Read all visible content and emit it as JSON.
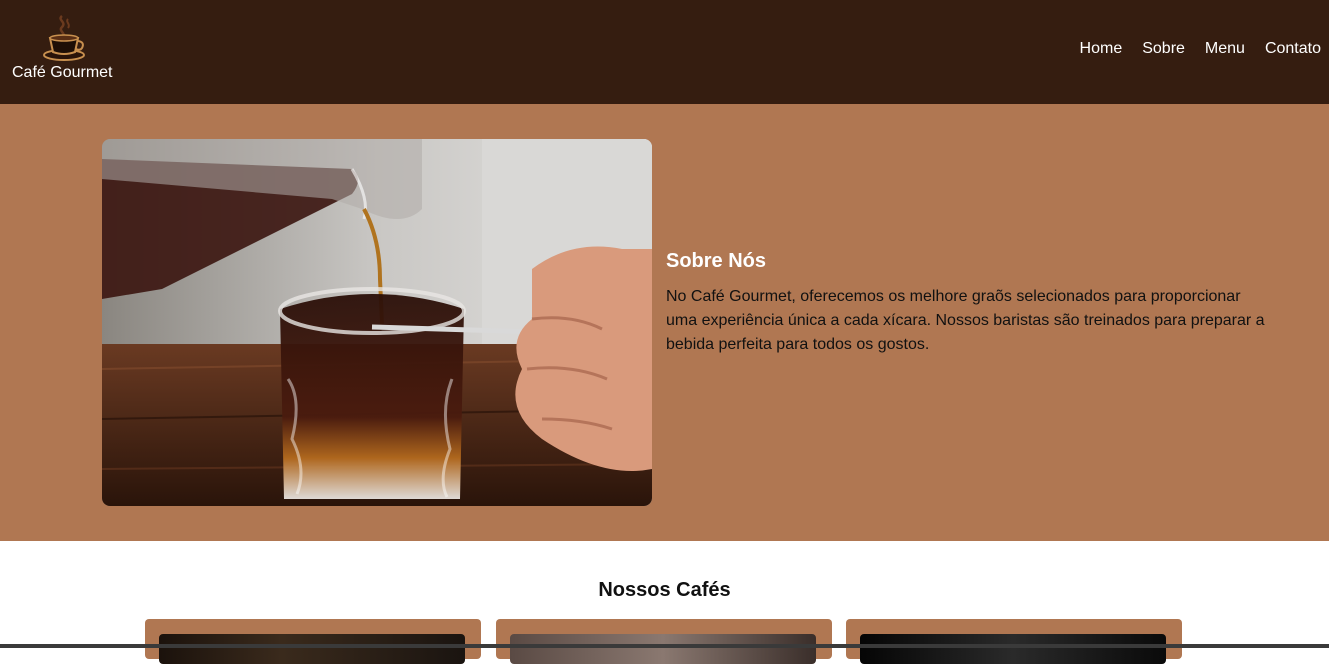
{
  "header": {
    "brand": "Café Gourmet",
    "nav": [
      "Home",
      "Sobre",
      "Menu",
      "Contato"
    ]
  },
  "about": {
    "title": "Sobre Nós",
    "body": "No Café Gourmet, oferecemos os melhore graõs selecionados para proporcionar uma experiência única a cada xícara. Nossos baristas são treinados para preparar a bebida perfeita para todos os gostos."
  },
  "coffees": {
    "title": "Nossos Cafés"
  },
  "colors": {
    "header_bg": "#351d10",
    "section_bg": "#b07752",
    "text_light": "#ffffff"
  }
}
